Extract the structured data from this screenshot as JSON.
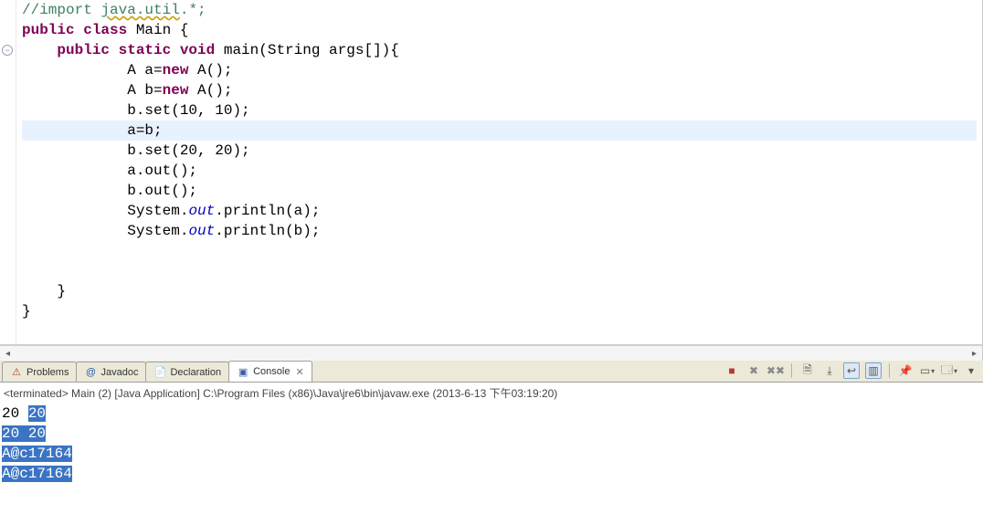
{
  "editor": {
    "lines": [
      {
        "segments": [
          {
            "cls": "c-comment",
            "text": "//import "
          },
          {
            "cls": "c-comment wave",
            "text": "java.util"
          },
          {
            "cls": "c-comment",
            "text": ".*;"
          }
        ],
        "fold": null
      },
      {
        "segments": [
          {
            "cls": "c-keyword",
            "text": "public class"
          },
          {
            "cls": "",
            "text": " Main {"
          }
        ],
        "fold": null
      },
      {
        "segments": [
          {
            "cls": "",
            "text": "    "
          },
          {
            "cls": "c-keyword",
            "text": "public static void"
          },
          {
            "cls": "",
            "text": " main(String args[]){"
          }
        ],
        "fold": "minus"
      },
      {
        "segments": [
          {
            "cls": "",
            "text": "            A a="
          },
          {
            "cls": "c-keyword",
            "text": "new"
          },
          {
            "cls": "",
            "text": " A();"
          }
        ],
        "fold": null
      },
      {
        "segments": [
          {
            "cls": "",
            "text": "            A b="
          },
          {
            "cls": "c-keyword",
            "text": "new"
          },
          {
            "cls": "",
            "text": " A();"
          }
        ],
        "fold": null
      },
      {
        "segments": [
          {
            "cls": "",
            "text": "            b.set(10, 10);"
          }
        ],
        "fold": null
      },
      {
        "segments": [
          {
            "cls": "",
            "text": "            a=b;"
          }
        ],
        "fold": null,
        "highlight": true
      },
      {
        "segments": [
          {
            "cls": "",
            "text": "            b.set(20, 20);"
          }
        ],
        "fold": null
      },
      {
        "segments": [
          {
            "cls": "",
            "text": "            a.out();"
          }
        ],
        "fold": null
      },
      {
        "segments": [
          {
            "cls": "",
            "text": "            b.out();"
          }
        ],
        "fold": null
      },
      {
        "segments": [
          {
            "cls": "",
            "text": "            System."
          },
          {
            "cls": "c-static-field",
            "text": "out"
          },
          {
            "cls": "",
            "text": ".println(a);"
          }
        ],
        "fold": null
      },
      {
        "segments": [
          {
            "cls": "",
            "text": "            System."
          },
          {
            "cls": "c-static-field",
            "text": "out"
          },
          {
            "cls": "",
            "text": ".println(b);"
          }
        ],
        "fold": null
      },
      {
        "segments": [
          {
            "cls": "",
            "text": ""
          }
        ],
        "fold": null
      },
      {
        "segments": [
          {
            "cls": "",
            "text": ""
          }
        ],
        "fold": null
      },
      {
        "segments": [
          {
            "cls": "",
            "text": "    }"
          }
        ],
        "fold": null
      },
      {
        "segments": [
          {
            "cls": "",
            "text": "}"
          }
        ],
        "fold": null
      }
    ]
  },
  "tabs": [
    {
      "id": "problems",
      "label": "Problems",
      "icon": "⚠",
      "icon_color": "#b43a3a",
      "active": false
    },
    {
      "id": "javadoc",
      "label": "Javadoc",
      "icon": "@",
      "icon_color": "#2a5ca8",
      "active": false
    },
    {
      "id": "declaration",
      "label": "Declaration",
      "icon": "📄",
      "icon_color": "#c48a16",
      "active": false
    },
    {
      "id": "console",
      "label": "Console",
      "icon": "▣",
      "icon_color": "#3a5ea3",
      "active": true
    }
  ],
  "toolbar": {
    "buttons": [
      {
        "name": "terminate-button",
        "glyph": "■",
        "cls": "red",
        "drop": false
      },
      {
        "name": "remove-launch-button",
        "glyph": "✖",
        "cls": "gray",
        "drop": false
      },
      {
        "name": "remove-all-terminated",
        "glyph": "✖✖",
        "cls": "gray",
        "drop": false
      },
      {
        "name": "separator-1",
        "sep": true
      },
      {
        "name": "clear-console-button",
        "glyph": "🗎",
        "cls": "",
        "drop": false
      },
      {
        "name": "scroll-lock-button",
        "glyph": "⤓",
        "cls": "",
        "drop": false
      },
      {
        "name": "word-wrap-button",
        "glyph": "↩",
        "cls": "boxed",
        "drop": false
      },
      {
        "name": "show-console-button",
        "glyph": "▥",
        "cls": "boxed",
        "drop": false
      },
      {
        "name": "separator-2",
        "sep": true
      },
      {
        "name": "pin-console-button",
        "glyph": "📌",
        "cls": "",
        "drop": false
      },
      {
        "name": "display-selected-console",
        "glyph": "▭",
        "cls": "",
        "drop": true
      },
      {
        "name": "open-console-button",
        "glyph": "🗔",
        "cls": "",
        "drop": true
      },
      {
        "name": "minimize-view-button",
        "glyph": "▾",
        "cls": "",
        "drop": false
      }
    ]
  },
  "status": {
    "text": "<terminated> Main (2) [Java Application] C:\\Program Files (x86)\\Java\\jre6\\bin\\javaw.exe (2013-6-13 下午03:19:20)"
  },
  "console": {
    "lines": [
      {
        "parts": [
          {
            "text": "20 ",
            "sel": false
          },
          {
            "text": "20",
            "sel": true
          }
        ]
      },
      {
        "parts": [
          {
            "text": "20 20",
            "sel": true
          }
        ]
      },
      {
        "parts": [
          {
            "text": "A@c17164",
            "sel": true
          }
        ]
      },
      {
        "parts": [
          {
            "text": "A@c17164",
            "sel": true
          }
        ]
      }
    ]
  }
}
